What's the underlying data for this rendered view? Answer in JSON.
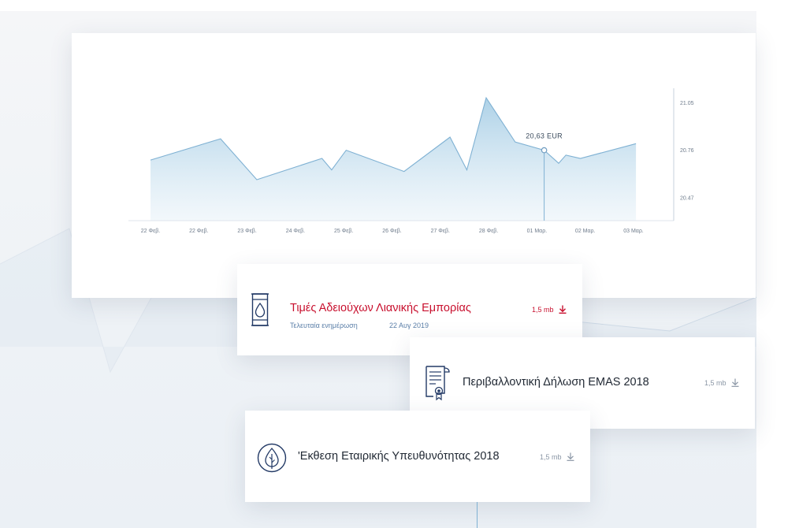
{
  "colors": {
    "accent_red": "#c8102e",
    "line_blue": "#7fb1d3",
    "navy": "#233a66",
    "meta_blue": "#5b7fa8"
  },
  "chart_data": {
    "type": "area",
    "x_categories": [
      "22 Φεβ.",
      "22 Φεβ.",
      "23 Φεβ.",
      "24 Φεβ.",
      "25 Φεβ.",
      "26 Φεβ.",
      "27 Φεβ.",
      "28 Φεβ.",
      "01 Μαρ.",
      "02 Μαρ.",
      "03 Μαρ."
    ],
    "series": [
      {
        "x_index": [
          0,
          1.45,
          2.2,
          3.55,
          3.75,
          4.05,
          5.25,
          6.2,
          6.55,
          6.95,
          7.55,
          8.15,
          8.45,
          8.6,
          8.9,
          10.05
        ],
        "values": [
          20.7,
          20.83,
          20.58,
          20.71,
          20.64,
          20.76,
          20.63,
          20.84,
          20.64,
          21.08,
          20.81,
          20.76,
          20.68,
          20.73,
          20.71,
          20.8
        ]
      }
    ],
    "y_ticks": [
      "21.05",
      "20.76",
      "20.47"
    ],
    "ylim": [
      20.33,
      21.09
    ],
    "y_axis_side": "right",
    "grid": false,
    "tooltip": {
      "x_index": 8.15,
      "value": 20.76,
      "label": "20,63 EUR"
    }
  },
  "documents": [
    {
      "title": "Τιμές Αδειούχων Λιανικής Εμπορίας",
      "size": "1,5 mb",
      "meta_label": "Τελευταία ενημέρωση",
      "meta_date": "22 Αυγ 2019",
      "icon": "oil-barrel-icon"
    },
    {
      "title": "Περιβαλλοντική Δήλωση EMAS 2018",
      "size": "1,5 mb",
      "icon": "certificate-icon"
    },
    {
      "title": "'Εκθεση Εταιρικής Υπευθυνότητας 2018",
      "size": "1,5 mb",
      "icon": "leaf-icon"
    }
  ]
}
